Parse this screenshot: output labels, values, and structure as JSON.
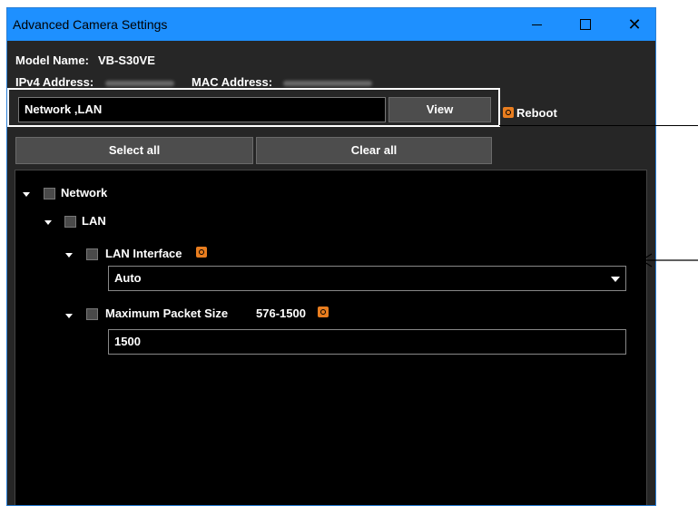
{
  "window": {
    "title": "Advanced Camera Settings",
    "controls": {
      "minimize": "—",
      "maximize": "☐",
      "close": "✕"
    }
  },
  "device": {
    "model_label": "Model Name:",
    "model_value": "VB-S30VE",
    "ipv4_label": "IPv4 Address:",
    "mac_label": "MAC Address:"
  },
  "toolbar": {
    "search_value": "Network ,LAN",
    "view_label": "View",
    "reboot_label": "Reboot",
    "select_all_label": "Select all",
    "clear_all_label": "Clear all"
  },
  "tree": {
    "network_label": "Network",
    "lan_label": "LAN",
    "lan_interface_label": "LAN Interface",
    "lan_interface_value": "Auto",
    "max_packet_label": "Maximum Packet Size",
    "max_packet_range": "576-1500",
    "max_packet_value": "1500"
  },
  "colors": {
    "titlebar": "#1e90ff",
    "panel": "#262626",
    "tree_background": "#000000",
    "accent_reboot": "#e87d1f"
  },
  "icons": [
    "power-icon",
    "chevron-down-icon",
    "checkbox-icon"
  ]
}
